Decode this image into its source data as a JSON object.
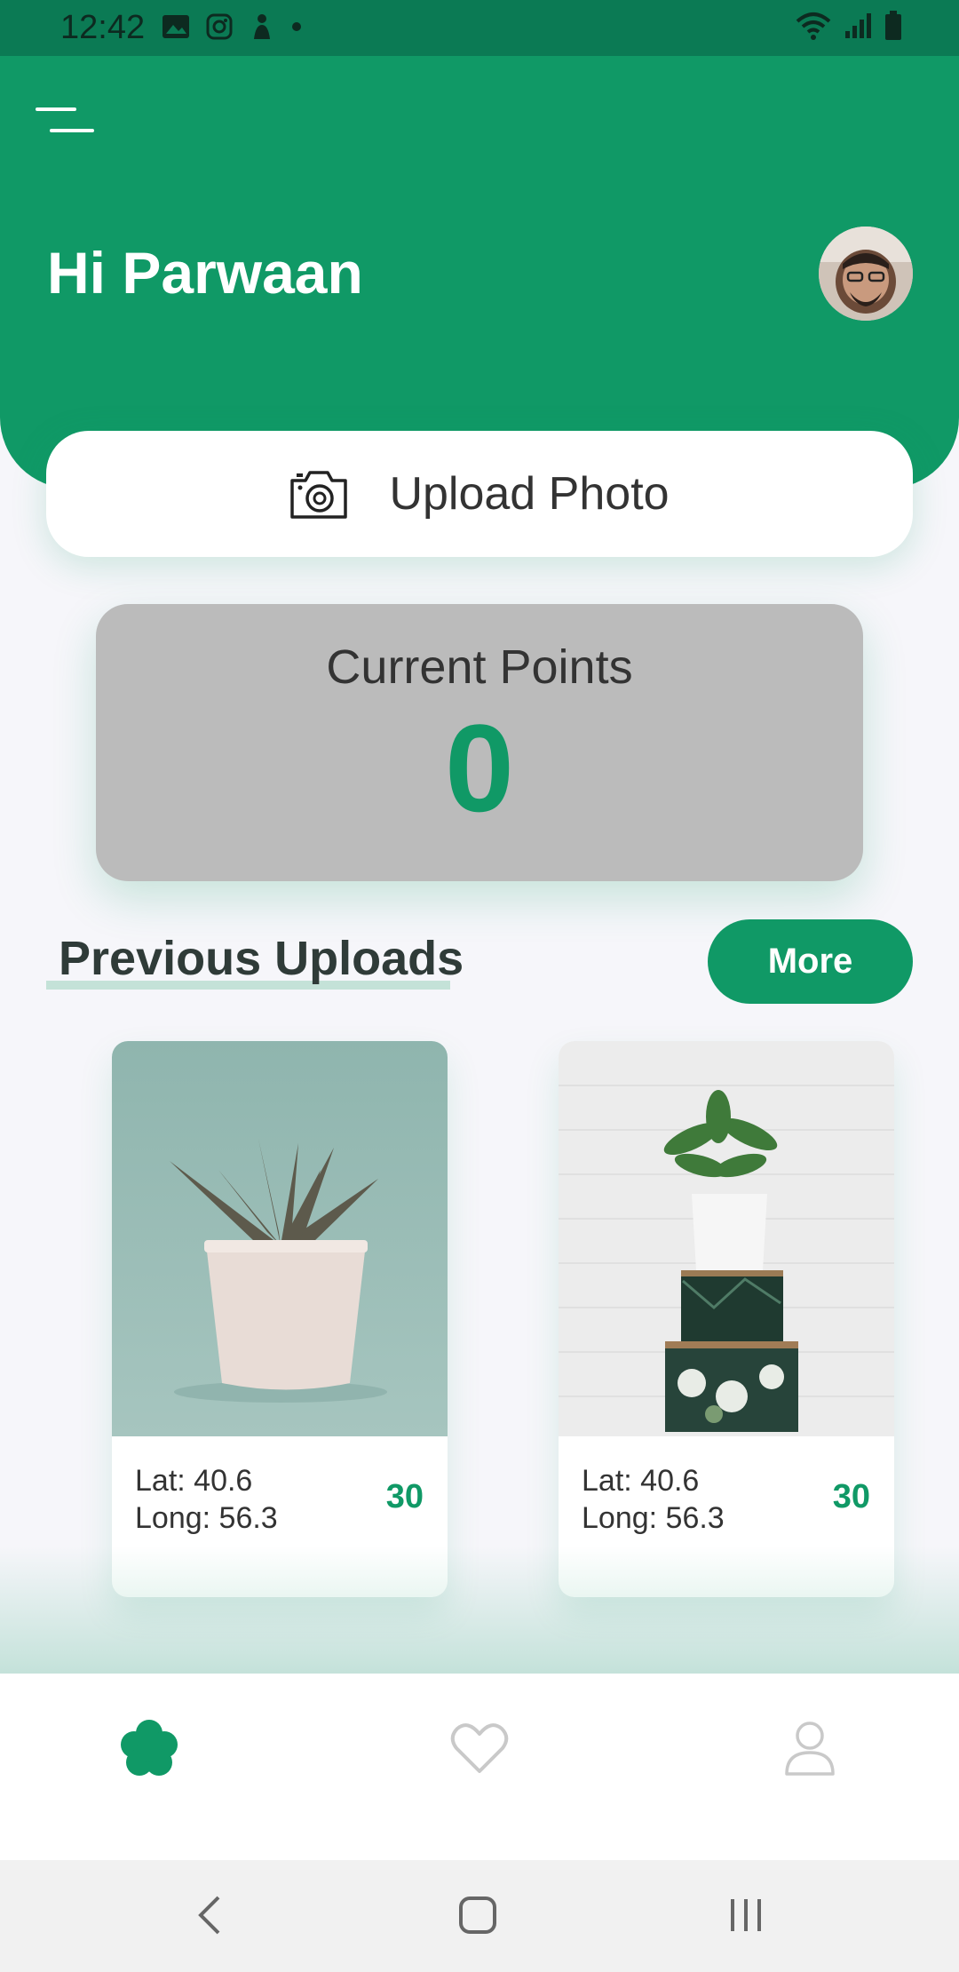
{
  "status_bar": {
    "time": "12:42",
    "left_icons": [
      "gallery-icon",
      "instagram-icon",
      "app-icon",
      "dot-icon"
    ],
    "right_icons": [
      "wifi-icon",
      "signal-icon",
      "battery-icon"
    ]
  },
  "header": {
    "greeting": "Hi Parwaan",
    "menu_icon": "menu-icon"
  },
  "upload": {
    "label": "Upload Photo",
    "icon": "camera-icon"
  },
  "points": {
    "label": "Current Points",
    "value": "0"
  },
  "previous_uploads": {
    "title": "Previous Uploads",
    "more_label": "More",
    "items": [
      {
        "lat": "Lat: 40.6",
        "long": "Long: 56.3",
        "points": "30",
        "image": "aloe-plant-photo"
      },
      {
        "lat": "Lat: 40.6",
        "long": "Long: 56.3",
        "points": "30",
        "image": "plant-on-boxes-photo"
      }
    ]
  },
  "bottom_nav": {
    "items": [
      "flower-icon",
      "heart-icon",
      "user-icon"
    ],
    "active": "flower-icon"
  },
  "colors": {
    "brand": "#109966",
    "status_bar": "#0b7a54",
    "points_card": "#bbbbbb"
  }
}
